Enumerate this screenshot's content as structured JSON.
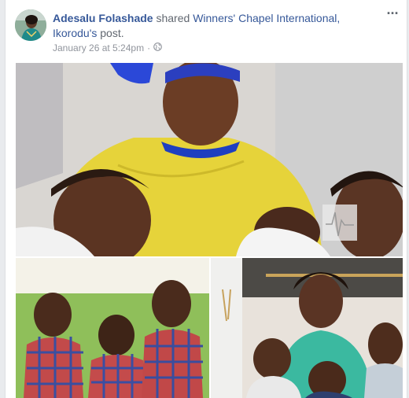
{
  "post": {
    "author_name": "Adesalu Folashade",
    "action_text": " shared ",
    "shared_page": "Winners' Chapel International, Ikorodu's",
    "post_word": " post.",
    "timestamp": "January 26 at 5:24pm",
    "separator": "·",
    "privacy_icon": "globe-icon",
    "more_icon": "ellipsis-icon",
    "more_label": "···"
  },
  "colors": {
    "link": "#365899",
    "meta": "#90949c",
    "card_bg": "#ffffff",
    "page_bg": "#e9ebee"
  },
  "photos": [
    {
      "name": "mother-with-quadruplets-photo"
    },
    {
      "name": "three-boys-on-sofa-photo"
    },
    {
      "name": "mother-smiling-with-boys-photo"
    }
  ]
}
